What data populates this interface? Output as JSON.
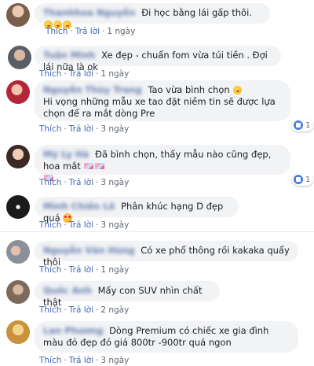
{
  "comments": [
    {
      "name": "Thanhhoa Nguyễn",
      "text": "Đi học bằng lái gấp thôi.",
      "emoji_count": 3,
      "like": "Thích",
      "reply": "Trả lời",
      "time": "1 ngày"
    },
    {
      "name": "Tuấn Minh",
      "text": "Xe đẹp - chuẩn fom vừa túi tiền . Đợi lái nữa là ok",
      "like": "Thích",
      "reply": "Trả lời",
      "time": "1 ngày"
    },
    {
      "name": "Nguyễn Thùy Trang",
      "text": "Tao vừa bình chọn",
      "text2": "Hi vọng những mẫu xe tao đặt niềm tin sẽ được lựa chọn để ra mắt dòng Pre",
      "like": "Thích",
      "reply": "Trả lời",
      "time": "3 ngày",
      "reactions": "1"
    },
    {
      "name": "Mỹ Ly Hà",
      "text": "Đã bình chọn, thấy mẫu nào cũng đẹp, hoa mắt",
      "like": "Thích",
      "reply": "Trả lời",
      "time": "3 ngày",
      "reactions": "1"
    },
    {
      "name": "Minh Chiến Lê",
      "text": "Phân khúc hạng D đẹp quá",
      "like": "Thích",
      "reply": "Trả lời",
      "time": "3 ngày"
    },
    {
      "name": "Nguyễn Văn Hùng",
      "text": "Có xe phổ thông rồi kakaka quẩy thôi",
      "like": "Thích",
      "reply": "Trả lời",
      "time": "1 ngày"
    },
    {
      "name": "Quốc Anh",
      "text": "Mấy con SUV nhìn chất thật",
      "like": "Thích",
      "reply": "Trả lời",
      "time": "2 ngày"
    },
    {
      "name": "Lan Phương",
      "text": "Dòng Premium có chiếc xe gia đình màu đỏ đẹp đó giá 800tr -900tr quá ngon",
      "like": "Thích",
      "reply": "Trả lời",
      "time": "3 ngày"
    }
  ],
  "colors": {
    "link": "#385898",
    "bubble": "#f2f3f5",
    "like_blue": "#4a7de3"
  }
}
